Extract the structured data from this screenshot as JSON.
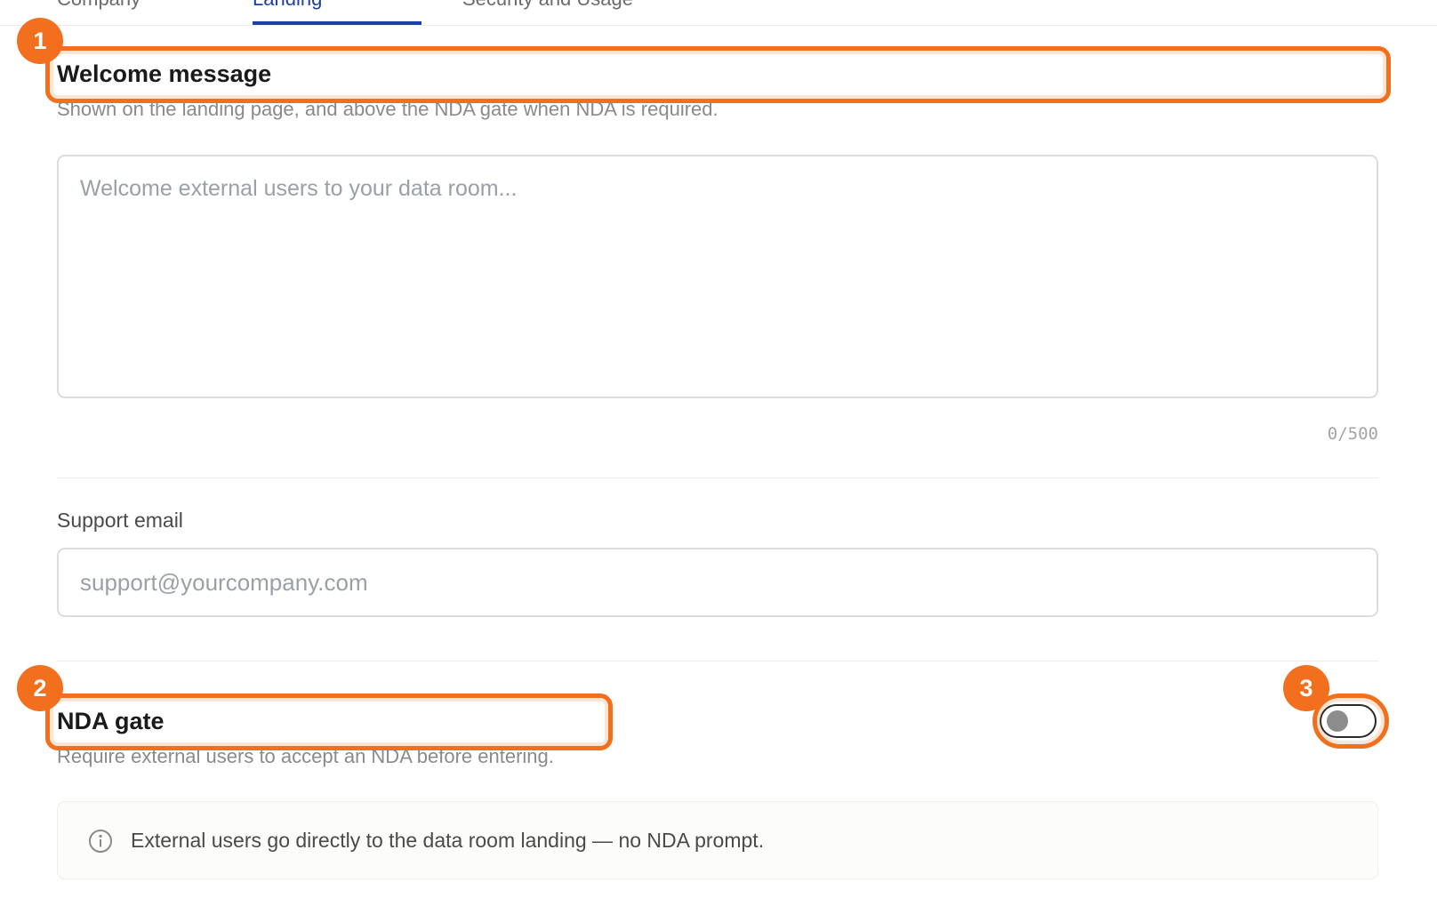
{
  "tabs": [
    {
      "label": "Company"
    },
    {
      "label": "Landing"
    },
    {
      "label": "Security and Usage"
    }
  ],
  "welcome": {
    "title": "Welcome message",
    "description": "Shown on the landing page, and above the NDA gate when NDA is required.",
    "placeholder": "Welcome external users to your data room...",
    "counter": "0/500"
  },
  "support": {
    "label": "Support email",
    "placeholder": "support@yourcompany.com"
  },
  "nda": {
    "title": "NDA gate",
    "description": "Require external users to accept an NDA before entering.",
    "enabled": false,
    "info_icon": "info-icon",
    "info": "External users go directly to the data room landing — no NDA prompt."
  },
  "annotations": [
    {
      "number": "1",
      "target": "Welcome message"
    },
    {
      "number": "2",
      "target": "NDA gate"
    },
    {
      "number": "3",
      "target": "NDA toggle"
    }
  ],
  "colors": {
    "accent": "#1d3fa8",
    "annotation": "#f26f1d"
  }
}
